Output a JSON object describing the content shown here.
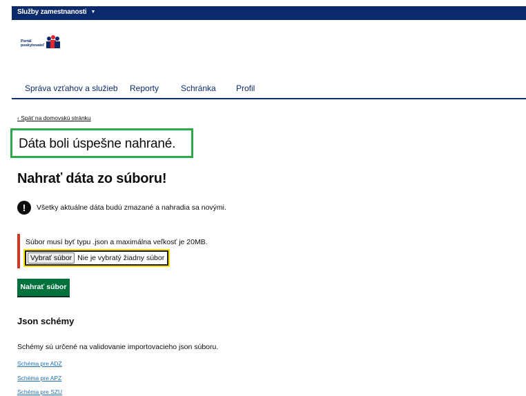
{
  "topbar": {
    "service_menu": "Služby zamestnanosti",
    "caret": "▼"
  },
  "logo": {
    "line1": "Portál",
    "line2": "poskytovateľ"
  },
  "nav": {
    "items": [
      "Správa vzťahov a služieb",
      "Reporty",
      "Schránka",
      "Profil"
    ]
  },
  "back_link": "‹ Späť na domovskú stránku",
  "success_message": "Dáta boli úspešne nahrané.",
  "page_title": "Nahrať dáta zo súboru!",
  "warning": {
    "icon": "!",
    "text": "Všetky aktuálne dáta budú zmazané a nahradia sa novými."
  },
  "upload_form": {
    "hint": "Súbor musí byť typu .json a maximálna veľkosť je 20MB.",
    "choose_button": "Vybrať súbor",
    "no_file_text": "Nie je vybratý žiadny súbor",
    "submit_label": "Nahrať súbor"
  },
  "schemas": {
    "heading": "Json schémy",
    "description": "Schémy sú určené na validovanie importovacieho json súboru.",
    "links": [
      "Schéma pre ADZ",
      "Schéma pre APZ",
      "Schéma pre SZU"
    ]
  },
  "colors": {
    "brand_navy": "#0b2a6b",
    "success_green": "#2ea84a",
    "button_green": "#00703c",
    "error_red": "#d4351c",
    "focus_yellow": "#ffdd00",
    "link_blue": "#1d70b8"
  }
}
